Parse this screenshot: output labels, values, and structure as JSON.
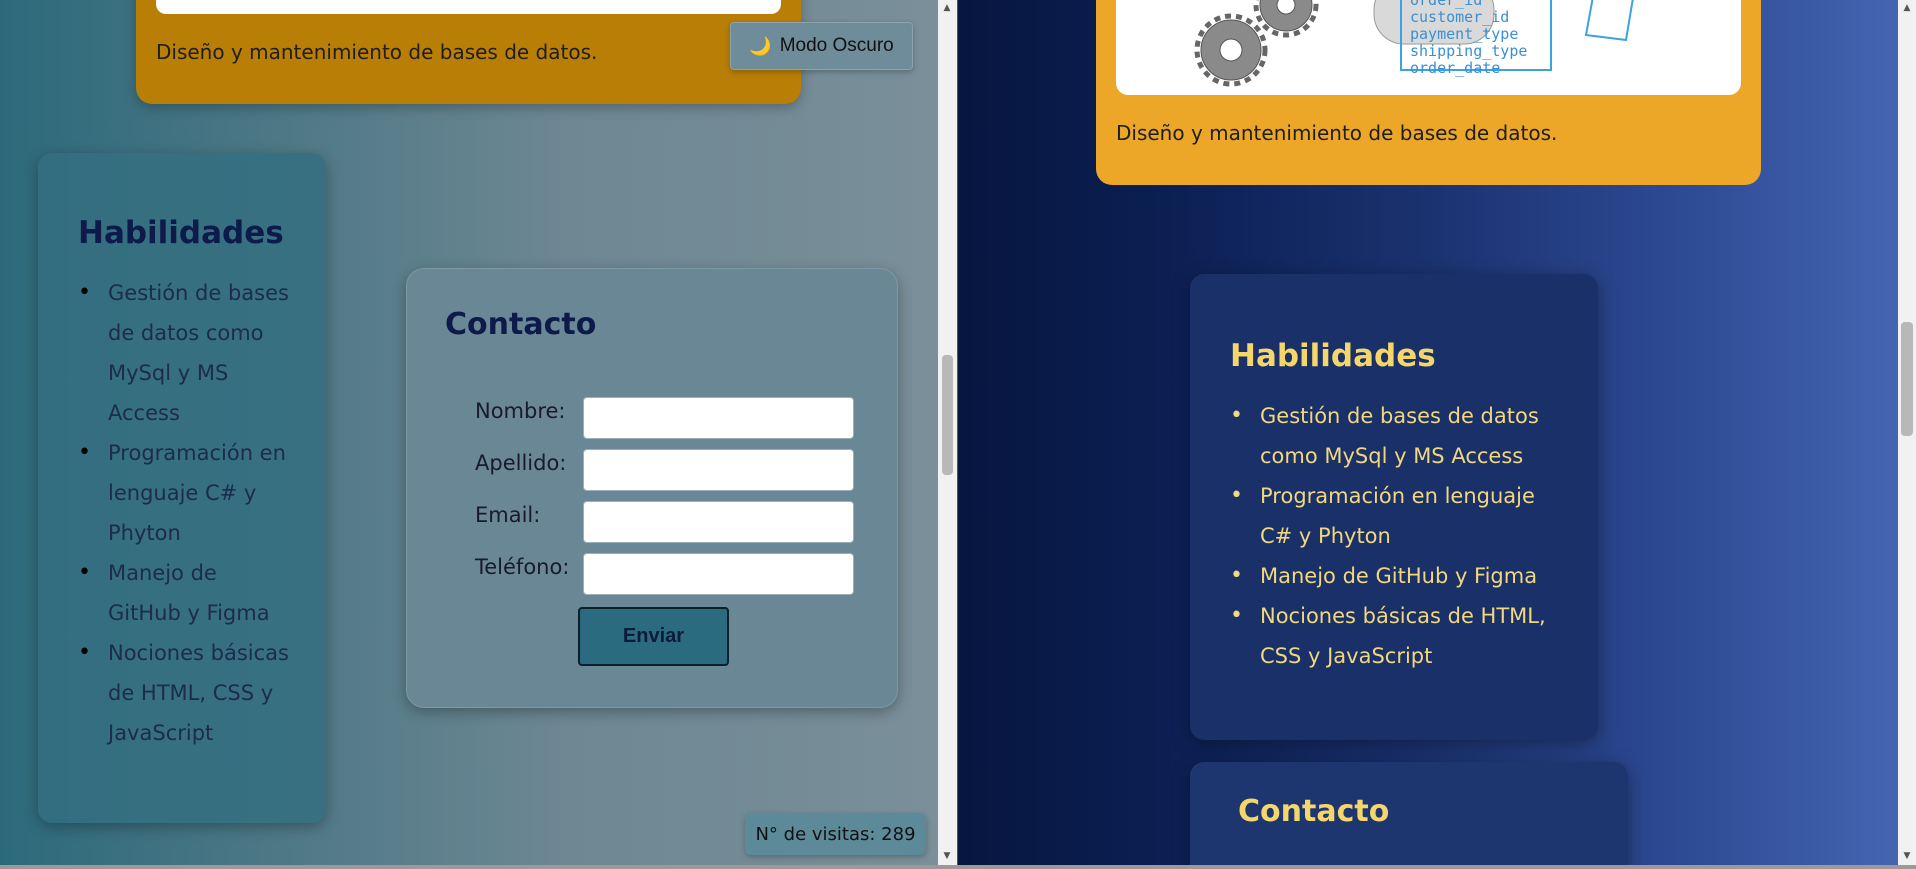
{
  "left_pane": {
    "top_card_description": "Diseño y mantenimiento de bases de datos.",
    "dark_mode_button": {
      "icon": "moon-icon",
      "label": "Modo Oscuro"
    },
    "skills": {
      "title": "Habilidades",
      "items": [
        "Gestión de bases de datos como MySql y MS Access",
        "Programación en lenguaje C# y Phyton",
        "Manejo de GitHub y Figma",
        "Nociones básicas de HTML, CSS y JavaScript"
      ]
    },
    "contact": {
      "title": "Contacto",
      "fields": [
        {
          "label": "Nombre:",
          "value": ""
        },
        {
          "label": "Apellido:",
          "value": ""
        },
        {
          "label": "Email:",
          "value": ""
        },
        {
          "label": "Teléfono:",
          "value": ""
        }
      ],
      "submit_label": "Enviar"
    },
    "visits_label": "N° de visitas: 289"
  },
  "right_pane": {
    "top_card_description": "Diseño y mantenimiento de bases de datos.",
    "image_text": [
      "order_id",
      "customer_id",
      "payment_type",
      "shipping_type",
      "order_date"
    ],
    "skills": {
      "title": "Habilidades",
      "items": [
        "Gestión de bases de datos como MySql y MS Access",
        "Programación en lenguaje C# y Phyton",
        "Manejo de GitHub y Figma",
        "Nociones básicas de HTML, CSS y JavaScript"
      ]
    },
    "contact": {
      "title": "Contacto"
    }
  },
  "colors": {
    "light_card": "#b97e06",
    "dark_card": "#eca628",
    "dark_accent_text": "#f4d66a",
    "light_heading": "#0d1a4a"
  }
}
